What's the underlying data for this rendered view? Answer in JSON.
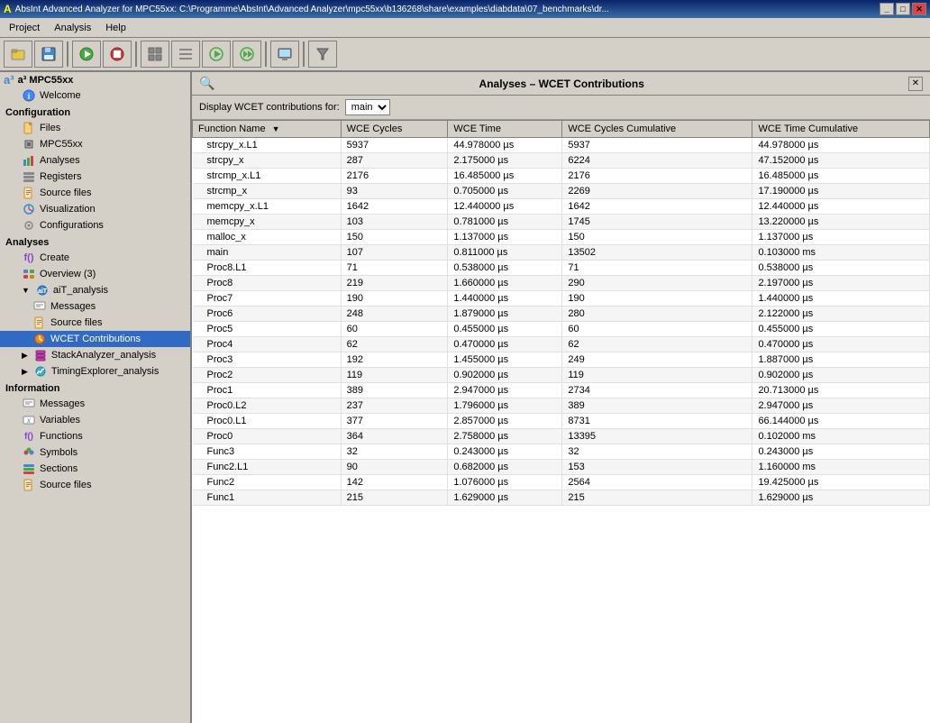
{
  "titleBar": {
    "icon": "A",
    "title": "AbsInt Advanced Analyzer for MPC55xx: C:\\Programme\\AbsInt\\Advanced Analyzer\\mpc55xx\\b136268\\share\\examples\\diabdata\\07_benchmarks\\dr...",
    "controls": [
      "_",
      "□",
      "✕"
    ]
  },
  "menu": {
    "items": [
      "Project",
      "Analysis",
      "Help"
    ]
  },
  "toolbar": {
    "buttons": [
      {
        "name": "open-folder",
        "icon": "📁"
      },
      {
        "name": "save",
        "icon": "💾"
      },
      {
        "name": "run",
        "icon": "▶"
      },
      {
        "name": "stop",
        "icon": "■"
      },
      {
        "name": "grid",
        "icon": "▦"
      },
      {
        "name": "list",
        "icon": "☰"
      },
      {
        "name": "play-outline",
        "icon": "▷"
      },
      {
        "name": "fast-forward",
        "icon": "▶▶"
      },
      {
        "name": "display",
        "icon": "🖥"
      },
      {
        "name": "filter",
        "icon": "⚗"
      }
    ]
  },
  "leftPanel": {
    "projectName": "a³ MPC55xx",
    "welcomeLabel": "Welcome",
    "configSection": "Configuration",
    "configItems": [
      {
        "label": "Files",
        "icon": "file"
      },
      {
        "label": "MPC55xx",
        "icon": "cpu"
      },
      {
        "label": "Analyses",
        "icon": "analyses"
      },
      {
        "label": "Registers",
        "icon": "registers"
      },
      {
        "label": "Source files",
        "icon": "sourcefiles"
      },
      {
        "label": "Visualization",
        "icon": "visualization"
      },
      {
        "label": "Configurations",
        "icon": "configurations"
      }
    ],
    "analysesSection": "Analyses",
    "analysesItems": [
      {
        "label": "Create",
        "icon": "fx",
        "indent": 0
      },
      {
        "label": "Overview (3)",
        "icon": "overview",
        "indent": 0
      },
      {
        "label": "aiT_analysis",
        "icon": "ait",
        "indent": 0,
        "expanded": true
      },
      {
        "label": "Messages",
        "icon": "messages",
        "indent": 1
      },
      {
        "label": "Source files",
        "icon": "sourcefiles",
        "indent": 1
      },
      {
        "label": "WCET Contributions",
        "icon": "wcet",
        "indent": 1,
        "active": true
      },
      {
        "label": "StackAnalyzer_analysis",
        "icon": "stack",
        "indent": 0
      },
      {
        "label": "TimingExplorer_analysis",
        "icon": "timing",
        "indent": 0
      }
    ],
    "infoSection": "Information",
    "infoItems": [
      {
        "label": "Messages",
        "icon": "messages"
      },
      {
        "label": "Variables",
        "icon": "variables"
      },
      {
        "label": "Functions",
        "icon": "functions"
      },
      {
        "label": "Symbols",
        "icon": "symbols"
      },
      {
        "label": "Sections",
        "icon": "sections"
      },
      {
        "label": "Source files",
        "icon": "sourcefiles2"
      }
    ]
  },
  "rightPanel": {
    "title": "Analyses – WCET Contributions",
    "filterLabel": "Display WCET contributions for:",
    "filterOptions": [
      "main"
    ],
    "filterSelected": "main",
    "columns": [
      {
        "label": "Function Name",
        "sort": true
      },
      {
        "label": "WCE Cycles"
      },
      {
        "label": "WCE Time"
      },
      {
        "label": "WCE Cycles Cumulative"
      },
      {
        "label": "WCE Time Cumulative"
      }
    ],
    "rows": [
      {
        "name": "strcpy_x.L1",
        "wceCycles": "5937",
        "wceTime": "44.978000 µs",
        "wceCyclesCum": "5937",
        "wceTimeCum": "44.978000 µs"
      },
      {
        "name": "strcpy_x",
        "wceCycles": "287",
        "wceTime": "2.175000 µs",
        "wceCyclesCum": "6224",
        "wceTimeCum": "47.152000 µs"
      },
      {
        "name": "strcmp_x.L1",
        "wceCycles": "2176",
        "wceTime": "16.485000 µs",
        "wceCyclesCum": "2176",
        "wceTimeCum": "16.485000 µs"
      },
      {
        "name": "strcmp_x",
        "wceCycles": "93",
        "wceTime": "0.705000 µs",
        "wceCyclesCum": "2269",
        "wceTimeCum": "17.190000 µs"
      },
      {
        "name": "memcpy_x.L1",
        "wceCycles": "1642",
        "wceTime": "12.440000 µs",
        "wceCyclesCum": "1642",
        "wceTimeCum": "12.440000 µs"
      },
      {
        "name": "memcpy_x",
        "wceCycles": "103",
        "wceTime": "0.781000 µs",
        "wceCyclesCum": "1745",
        "wceTimeCum": "13.220000 µs"
      },
      {
        "name": "malloc_x",
        "wceCycles": "150",
        "wceTime": "1.137000 µs",
        "wceCyclesCum": "150",
        "wceTimeCum": "1.137000 µs"
      },
      {
        "name": "main",
        "wceCycles": "107",
        "wceTime": "0.811000 µs",
        "wceCyclesCum": "13502",
        "wceTimeCum": "0.103000 ms"
      },
      {
        "name": "Proc8.L1",
        "wceCycles": "71",
        "wceTime": "0.538000 µs",
        "wceCyclesCum": "71",
        "wceTimeCum": "0.538000 µs"
      },
      {
        "name": "Proc8",
        "wceCycles": "219",
        "wceTime": "1.660000 µs",
        "wceCyclesCum": "290",
        "wceTimeCum": "2.197000 µs"
      },
      {
        "name": "Proc7",
        "wceCycles": "190",
        "wceTime": "1.440000 µs",
        "wceCyclesCum": "190",
        "wceTimeCum": "1.440000 µs"
      },
      {
        "name": "Proc6",
        "wceCycles": "248",
        "wceTime": "1.879000 µs",
        "wceCyclesCum": "280",
        "wceTimeCum": "2.122000 µs"
      },
      {
        "name": "Proc5",
        "wceCycles": "60",
        "wceTime": "0.455000 µs",
        "wceCyclesCum": "60",
        "wceTimeCum": "0.455000 µs"
      },
      {
        "name": "Proc4",
        "wceCycles": "62",
        "wceTime": "0.470000 µs",
        "wceCyclesCum": "62",
        "wceTimeCum": "0.470000 µs"
      },
      {
        "name": "Proc3",
        "wceCycles": "192",
        "wceTime": "1.455000 µs",
        "wceCyclesCum": "249",
        "wceTimeCum": "1.887000 µs"
      },
      {
        "name": "Proc2",
        "wceCycles": "119",
        "wceTime": "0.902000 µs",
        "wceCyclesCum": "119",
        "wceTimeCum": "0.902000 µs"
      },
      {
        "name": "Proc1",
        "wceCycles": "389",
        "wceTime": "2.947000 µs",
        "wceCyclesCum": "2734",
        "wceTimeCum": "20.713000 µs"
      },
      {
        "name": "Proc0.L2",
        "wceCycles": "237",
        "wceTime": "1.796000 µs",
        "wceCyclesCum": "389",
        "wceTimeCum": "2.947000 µs"
      },
      {
        "name": "Proc0.L1",
        "wceCycles": "377",
        "wceTime": "2.857000 µs",
        "wceCyclesCum": "8731",
        "wceTimeCum": "66.144000 µs"
      },
      {
        "name": "Proc0",
        "wceCycles": "364",
        "wceTime": "2.758000 µs",
        "wceCyclesCum": "13395",
        "wceTimeCum": "0.102000 ms"
      },
      {
        "name": "Func3",
        "wceCycles": "32",
        "wceTime": "0.243000 µs",
        "wceCyclesCum": "32",
        "wceTimeCum": "0.243000 µs"
      },
      {
        "name": "Func2.L1",
        "wceCycles": "90",
        "wceTime": "0.682000 µs",
        "wceCyclesCum": "153",
        "wceTimeCum": "1.160000 ms"
      },
      {
        "name": "Func2",
        "wceCycles": "142",
        "wceTime": "1.076000 µs",
        "wceCyclesCum": "2564",
        "wceTimeCum": "19.425000 µs"
      },
      {
        "name": "Func1",
        "wceCycles": "215",
        "wceTime": "1.629000 µs",
        "wceCyclesCum": "215",
        "wceTimeCum": "1.629000 µs"
      }
    ]
  }
}
